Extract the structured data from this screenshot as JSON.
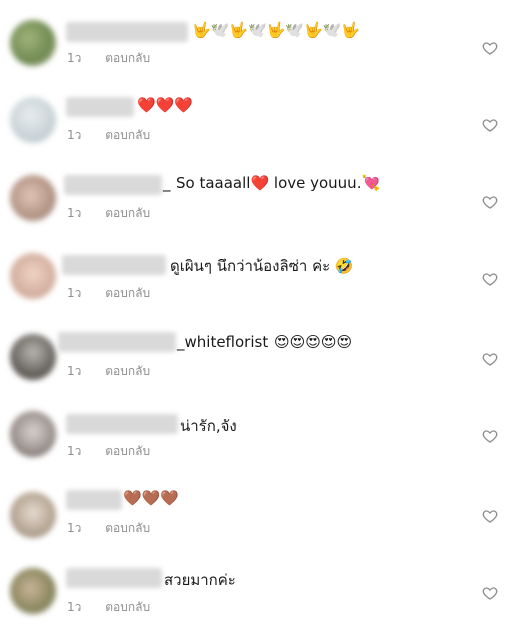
{
  "comments": [
    {
      "time": "1ว",
      "reply": "ตอบกลับ",
      "suffix": "",
      "text": "🤟🕊️🤟🕊️🤟🕊️🤟🕊️🤟"
    },
    {
      "time": "1ว",
      "reply": "ตอบกลับ",
      "suffix": "",
      "text": "❤️❤️❤️"
    },
    {
      "time": "1ว",
      "reply": "ตอบกลับ",
      "suffix": "_",
      "text": "So taaaall❤️ love youuu.💘"
    },
    {
      "time": "1ว",
      "reply": "ตอบกลับ",
      "suffix": "",
      "text": "ดูเผินๆ นึกว่าน้องลิซ่า ค่ะ 🤣"
    },
    {
      "time": "1ว",
      "reply": "ตอบกลับ",
      "suffix": "_whiteflorist",
      "text": "😍😍😍😍😍"
    },
    {
      "time": "1ว",
      "reply": "ตอบกลับ",
      "suffix": "",
      "text": "น่ารัก,จัง"
    },
    {
      "time": "1ว",
      "reply": "ตอบกลับ",
      "suffix": "",
      "text": "🤎🤎🤎"
    },
    {
      "time": "1ว",
      "reply": "ตอบกลับ",
      "suffix": "",
      "text": "สวยมากค่ะ"
    }
  ],
  "colors": {
    "meta": "#8e8e8e",
    "text": "#1a1a1a",
    "heart_outline": "#8e8e8e"
  },
  "icons": {
    "like": "heart-outline-icon"
  }
}
